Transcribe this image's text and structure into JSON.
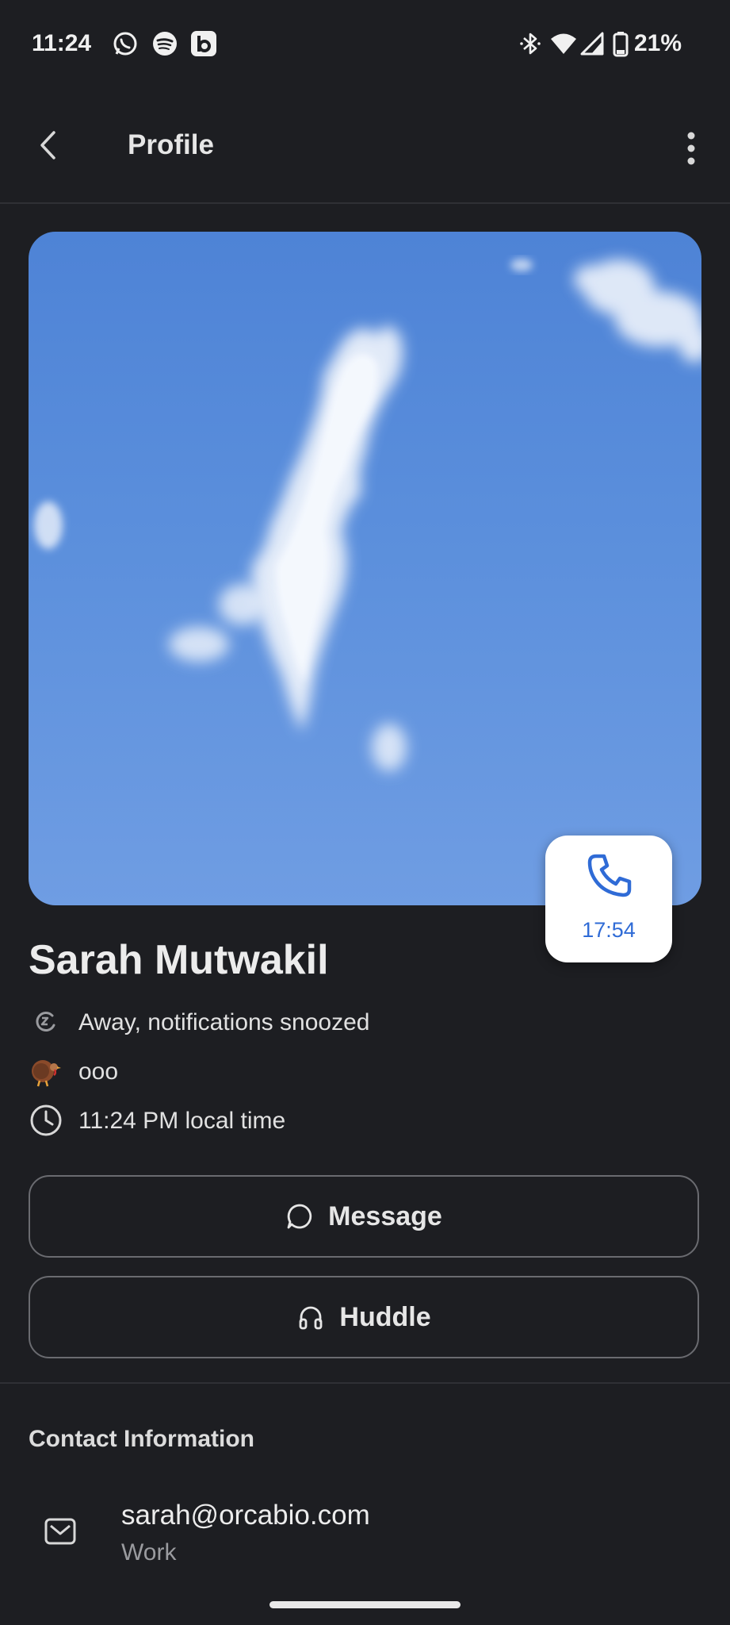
{
  "status_bar": {
    "time": "11:24",
    "battery": "21%",
    "left_icons": [
      "whatsapp-icon",
      "spotify-icon",
      "b-app-icon"
    ],
    "right_icons": [
      "bluetooth-icon",
      "wifi-icon",
      "signal-icon",
      "battery-icon"
    ]
  },
  "app_bar": {
    "title": "Profile"
  },
  "profile": {
    "name": "Sarah Mutwakil",
    "status_text": "Away, notifications snoozed",
    "custom_status": "ooo",
    "local_time": "11:24 PM local time",
    "call_duration": "17:54"
  },
  "actions": {
    "message_label": "Message",
    "huddle_label": "Huddle"
  },
  "contact": {
    "section_title": "Contact Information",
    "email": "sarah@orcabio.com",
    "email_type": "Work"
  },
  "colors": {
    "background": "#1d1e22",
    "accent": "#2f6bd6",
    "photo_sky": "#5b8fdc"
  }
}
